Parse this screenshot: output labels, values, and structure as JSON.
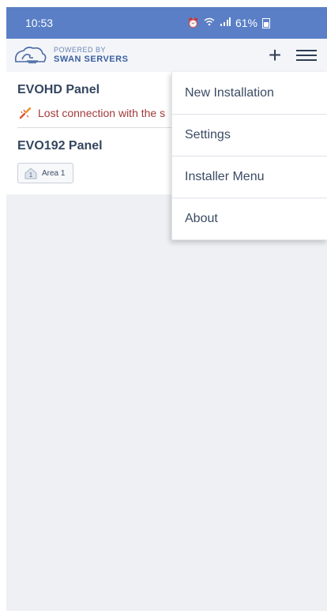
{
  "status_bar": {
    "time": "10:53",
    "battery": "61%",
    "icons": [
      "alarm-icon",
      "wifi-icon",
      "signal-icon",
      "battery-icon"
    ]
  },
  "header": {
    "logo_small": "POWERED BY",
    "logo_big": "SWAN SERVERS",
    "add_icon": "plus-icon",
    "menu_icon": "hamburger-icon"
  },
  "panels": [
    {
      "title": "EVOHD Panel",
      "notice": "Lost connection with the s"
    },
    {
      "title": "EVO192 Panel",
      "area_number": "1",
      "area_label": "Area 1"
    }
  ],
  "menu": {
    "items": [
      {
        "label": "New Installation"
      },
      {
        "label": "Settings"
      },
      {
        "label": "Installer Menu"
      },
      {
        "label": "About"
      }
    ]
  },
  "colors": {
    "status_bar": "#5a7fc6",
    "header_bg": "#f4f5f8",
    "page_bg": "#eef0f3",
    "title_text": "#34465f",
    "warning_text": "#a13a3a"
  }
}
